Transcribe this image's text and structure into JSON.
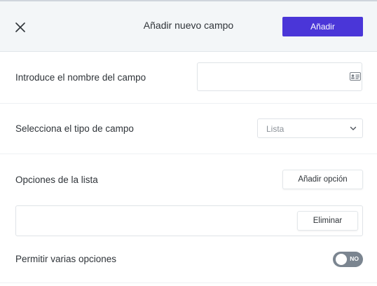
{
  "header": {
    "title": "Añadir nuevo campo",
    "add_button": "Añadir"
  },
  "field_name": {
    "label": "Introduce el nombre del campo",
    "value": "",
    "placeholder": ""
  },
  "field_type": {
    "label": "Selecciona el tipo de campo",
    "selected": "Lista"
  },
  "list_options": {
    "label": "Opciones de la lista",
    "add_option_button": "Añadir opción",
    "options": [
      {
        "value": "",
        "delete_button": "Eliminar"
      }
    ]
  },
  "multi_select": {
    "label": "Permitir varias opciones",
    "toggle_text": "NO"
  },
  "colors": {
    "accent": "#4a36d8",
    "header_bg": "#f3f6f8",
    "toggle_off": "#7b8590"
  }
}
